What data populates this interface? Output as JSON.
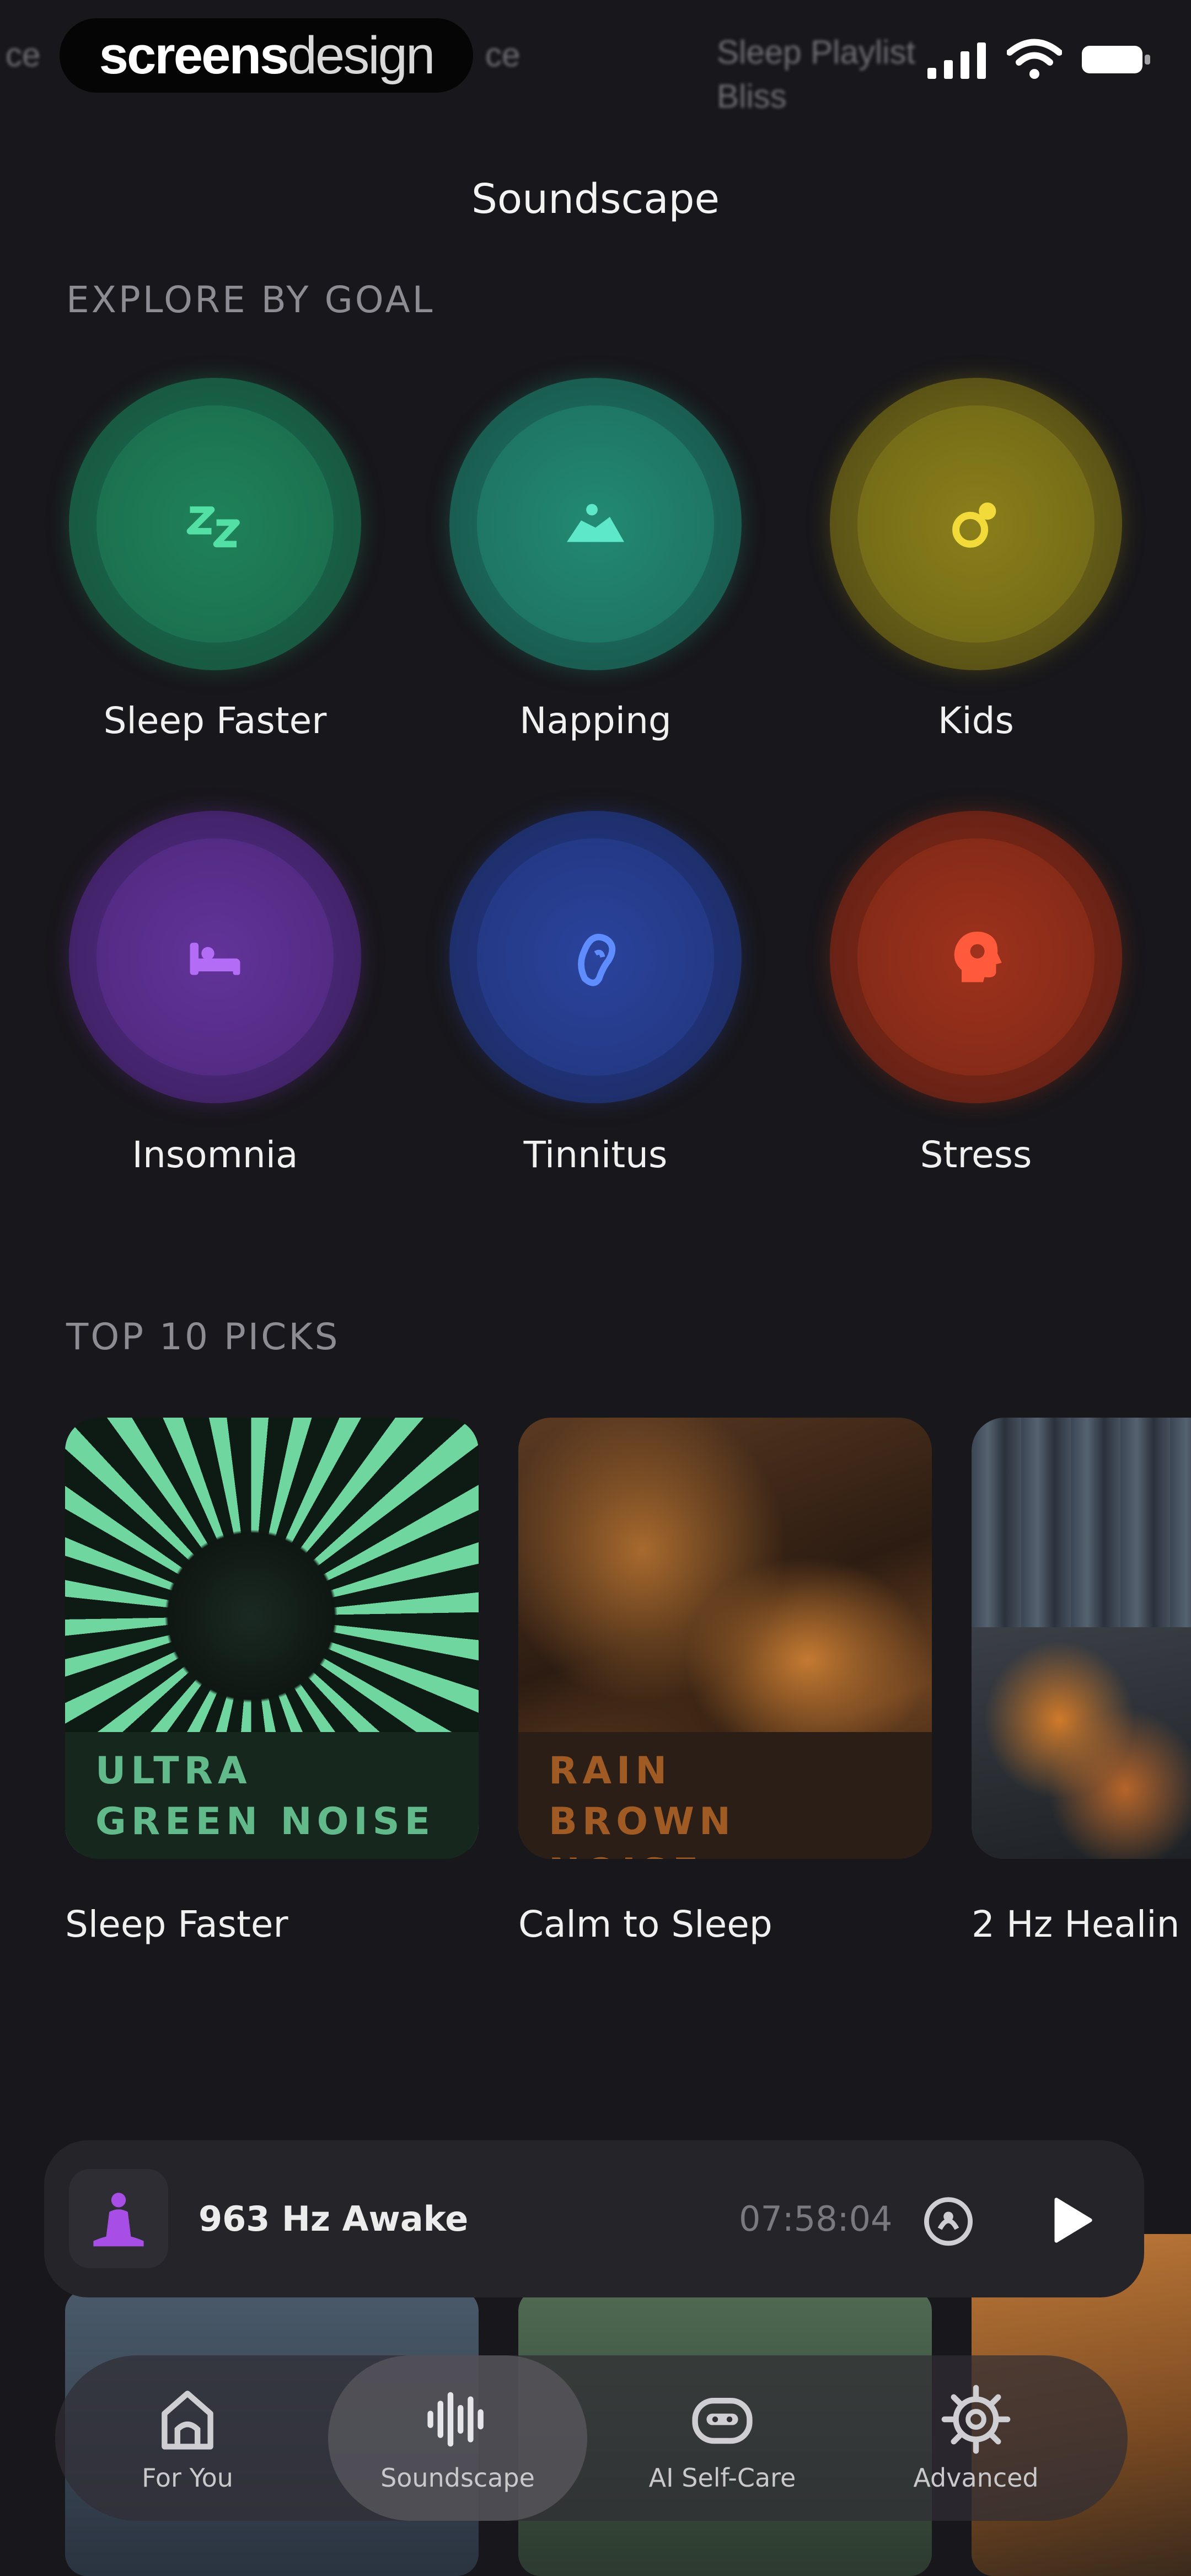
{
  "status": {
    "watermark_bold": "screens",
    "watermark_light": "design",
    "left_ghost": "ce",
    "right_ghost_line1": "Sleep Playlist",
    "right_ghost_line2": "Bliss"
  },
  "header": {
    "title": "Soundscape"
  },
  "explore": {
    "heading": "EXPLORE BY GOAL",
    "goals": [
      {
        "label": "Sleep Faster",
        "icon": "zzz-icon",
        "color": "#1f8c61"
      },
      {
        "label": "Napping",
        "icon": "napping-icon",
        "color": "#1f8f78"
      },
      {
        "label": "Kids",
        "icon": "pacifier-icon",
        "color": "#8d8218"
      },
      {
        "label": "Insomnia",
        "icon": "bed-icon",
        "color": "#6c34a6"
      },
      {
        "label": "Tinnitus",
        "icon": "ear-icon",
        "color": "#2d46a6"
      },
      {
        "label": "Stress",
        "icon": "head-icon",
        "color": "#a7331c"
      }
    ]
  },
  "picks": {
    "heading": "TOP 10 PICKS",
    "items": [
      {
        "band_line1": "ULTRA",
        "band_line2": "GREEN NOISE",
        "label": "Sleep Faster"
      },
      {
        "band_line1": "RAIN",
        "band_line2": "BROWN NOISE",
        "label": "Calm to Sleep"
      },
      {
        "band_line1": "",
        "band_line2": "",
        "label": "2 Hz Healin"
      }
    ]
  },
  "player": {
    "title": "963 Hz Awake",
    "time": "07:58:04",
    "icon": "meditation-icon"
  },
  "tabs": [
    {
      "label": "For You",
      "icon": "home-icon",
      "active": false
    },
    {
      "label": "Soundscape",
      "icon": "waveform-icon",
      "active": true
    },
    {
      "label": "AI Self-Care",
      "icon": "robot-icon",
      "active": false
    },
    {
      "label": "Advanced",
      "icon": "gear-icon",
      "active": false
    }
  ]
}
